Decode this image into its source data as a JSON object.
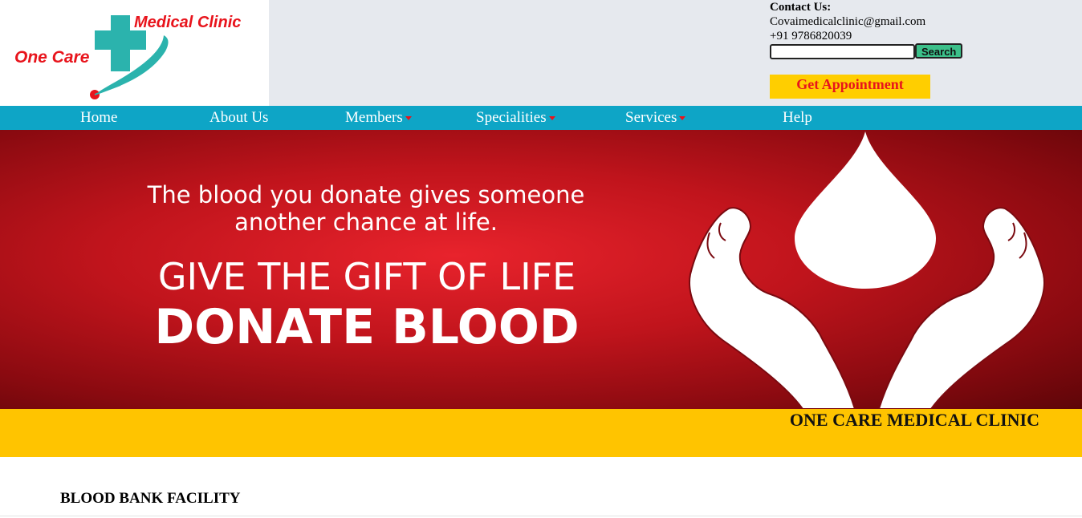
{
  "logo": {
    "medical_text": "Medical Clinic",
    "onecare_text": "One Care",
    "icon": "medical-cross-icon"
  },
  "contact": {
    "title": "Contact Us:",
    "email": "Covaimedicalclinic@gmail.com",
    "phone": "+91 9786820039"
  },
  "search": {
    "value": "",
    "placeholder": "",
    "button_label": "Search"
  },
  "appointment": {
    "label": "Get Appointment"
  },
  "nav": {
    "items": [
      {
        "label": "Home"
      },
      {
        "label": "About Us"
      },
      {
        "label": "Members"
      },
      {
        "label": "Specialities"
      },
      {
        "label": "Services"
      },
      {
        "label": "Help"
      }
    ]
  },
  "banner": {
    "line1": "The blood you donate gives someone",
    "line2": "another chance at life.",
    "headline": "GIVE THE GIFT OF LIFE",
    "subheadline": "DONATE BLOOD",
    "art": "hands-holding-blood-drop-icon"
  },
  "band": {
    "clinic_name": "ONE CARE MEDICAL CLINIC"
  },
  "section": {
    "title": "BLOOD BANK FACILITY"
  },
  "colors": {
    "nav_bg": "#0ea5c6",
    "accent_red": "#e8141c",
    "yellow": "#ffc400",
    "logo_teal": "#27b2ac"
  }
}
